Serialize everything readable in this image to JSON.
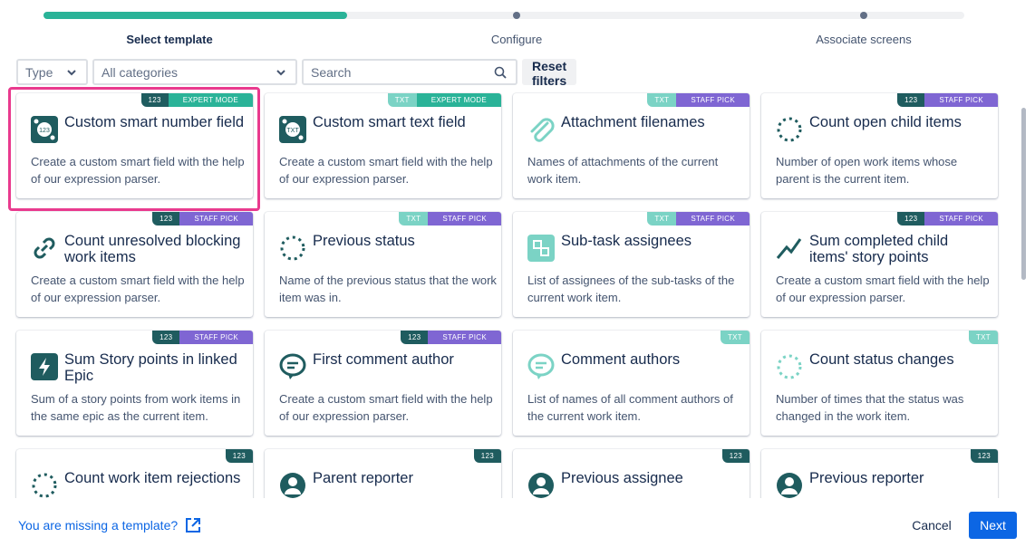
{
  "stepper": {
    "progress_percent": 33,
    "steps": [
      {
        "label": "Select template",
        "active": true
      },
      {
        "label": "Configure",
        "active": false
      },
      {
        "label": "Associate screens",
        "active": false
      }
    ]
  },
  "filters": {
    "type_value": "Type",
    "category_value": "All categories",
    "search_placeholder": "Search",
    "reset_label": "Reset filters"
  },
  "colors": {
    "accent_teal": "#2ab398",
    "badge_num": "#1f5c5f",
    "badge_txt": "#7bd3c5",
    "badge_staff": "#7f66d3",
    "highlight": "#e93a8e",
    "primary": "#0c66e4"
  },
  "cards": [
    {
      "title": "Custom smart number field",
      "desc": "Create a custom smart field with the help of our expression parser.",
      "badges": [
        "123",
        "EXPERT MODE"
      ],
      "icon": "gear-number-icon"
    },
    {
      "title": "Custom smart text field",
      "desc": "Create a custom smart field with the help of our expression parser.",
      "badges": [
        "TXT",
        "EXPERT MODE"
      ],
      "icon": "gear-text-icon"
    },
    {
      "title": "Attachment filenames",
      "desc": "Names of attachments of the current work item.",
      "badges": [
        "TXT",
        "STAFF PICK"
      ],
      "icon": "paperclip-icon"
    },
    {
      "title": "Count open child items",
      "desc": "Number of open work items whose parent is the current item.",
      "badges": [
        "123",
        "STAFF PICK"
      ],
      "icon": "dotted-circle-icon"
    },
    {
      "title": "Count unresolved blocking work items",
      "desc": "Create a custom smart field with the help of our expression parser.",
      "badges": [
        "123",
        "STAFF PICK"
      ],
      "icon": "link-icon"
    },
    {
      "title": "Previous status",
      "desc": "Name of the previous status that the work item was in.",
      "badges": [
        "TXT",
        "STAFF PICK"
      ],
      "icon": "dotted-circle-icon"
    },
    {
      "title": "Sub-task assignees",
      "desc": "List of assignees of the sub-tasks of the current work item.",
      "badges": [
        "TXT",
        "STAFF PICK"
      ],
      "icon": "subtask-icon"
    },
    {
      "title": "Sum completed child items' story points",
      "desc": "Create a custom smart field with the help of our expression parser.",
      "badges": [
        "123",
        "STAFF PICK"
      ],
      "icon": "trend-icon"
    },
    {
      "title": "Sum Story points in linked Epic",
      "desc": "Sum of a story points from work items in the same epic as the current item.",
      "badges": [
        "123",
        "STAFF PICK"
      ],
      "icon": "bolt-icon"
    },
    {
      "title": "First comment author",
      "desc": "Create a custom smart field with the help of our expression parser.",
      "badges": [
        "123",
        "STAFF PICK"
      ],
      "icon": "comment-icon"
    },
    {
      "title": "Comment authors",
      "desc": "List of names of all comment authors of the current work item.",
      "badges": [
        "TXT"
      ],
      "icon": "comment-light-icon"
    },
    {
      "title": "Count status changes",
      "desc": "Number of times that the status was changed in the work item.",
      "badges": [
        "TXT"
      ],
      "icon": "dotted-circle-light-icon"
    },
    {
      "title": "Count work item rejections",
      "desc": "",
      "badges": [
        "123"
      ],
      "icon": "dotted-circle-icon"
    },
    {
      "title": "Parent reporter",
      "desc": "",
      "badges": [
        "123"
      ],
      "icon": "user-icon"
    },
    {
      "title": "Previous assignee",
      "desc": "",
      "badges": [
        "123"
      ],
      "icon": "user-icon"
    },
    {
      "title": "Previous reporter",
      "desc": "",
      "badges": [
        "123"
      ],
      "icon": "user-icon"
    }
  ],
  "footer": {
    "missing_template_link": "You are missing a template?",
    "cancel_label": "Cancel",
    "next_label": "Next"
  }
}
